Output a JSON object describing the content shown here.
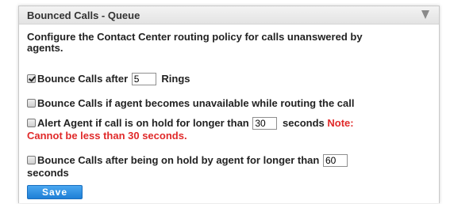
{
  "header": {
    "title": "Bounced Calls - Queue"
  },
  "description": "Configure the Contact Center routing policy for calls unanswered by agents.",
  "options": {
    "bounce_rings": {
      "prefix": "Bounce Calls after",
      "value": "5",
      "suffix": "Rings",
      "checked": true
    },
    "agent_unavailable": {
      "label": "Bounce Calls if agent becomes unavailable while routing the call",
      "checked": false
    },
    "alert_hold": {
      "prefix": "Alert Agent if call is on hold for longer than",
      "value": "30",
      "suffix": "seconds",
      "note": "Note: Cannot be less than 30 seconds.",
      "checked": false
    },
    "bounce_hold": {
      "prefix": "Bounce Calls after being on hold by agent for longer than",
      "value": "60",
      "suffix": "seconds",
      "checked": false
    }
  },
  "buttons": {
    "save": "Save"
  },
  "colors": {
    "note": "#e02a2a",
    "save_button": "#2b8be0",
    "header_bg": "#e9e9e9"
  }
}
